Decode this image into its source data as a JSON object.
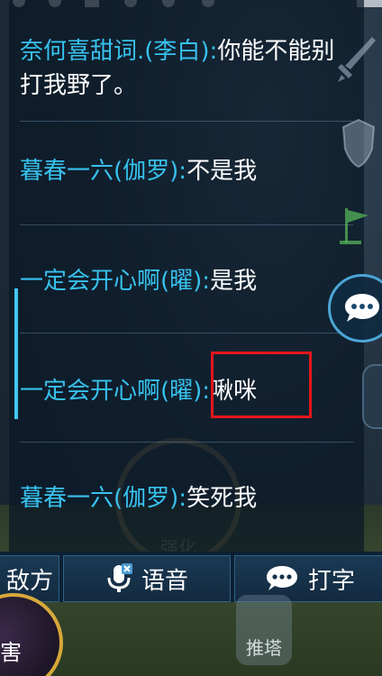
{
  "chat": {
    "messages": [
      {
        "sender": "奈何喜甜词.(李白):",
        "text": "你能不能别打我野了。"
      },
      {
        "sender": "暮春一六(伽罗):",
        "text": "不是我"
      },
      {
        "sender": "一定会开心啊(曜):",
        "text": "是我"
      },
      {
        "sender": "一定会开心啊(曜):",
        "text": "啾咪"
      },
      {
        "sender": "暮春一六(伽罗):",
        "text": "笑死我"
      }
    ]
  },
  "bottom_bar": {
    "enemy_label": "敌方",
    "voice_label": "语音",
    "type_label": "打字"
  },
  "hud": {
    "background_skill_label": "强化",
    "tower_label": "推塔",
    "avatar_label": "害"
  },
  "colors": {
    "sender": "#37c2ee",
    "message": "#ffffff",
    "highlight": "#e5161c",
    "accent": "#42c7f0"
  }
}
